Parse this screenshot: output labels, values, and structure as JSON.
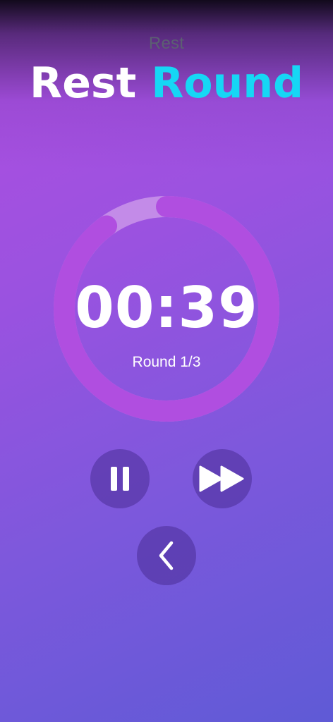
{
  "header": {
    "status": "Rest",
    "title_part1": "Rest",
    "title_part2": "Round"
  },
  "timer": {
    "time": "00:39",
    "round": "Round 1/3",
    "remaining_fraction": 0.9
  },
  "colors": {
    "title_accent": "#16d7f5",
    "ring_progress": "#b04ee0",
    "ring_track": "#c38be8"
  },
  "controls": {
    "pause_icon": "pause-icon",
    "skip_icon": "fast-forward-icon",
    "back_icon": "chevron-left-icon"
  }
}
